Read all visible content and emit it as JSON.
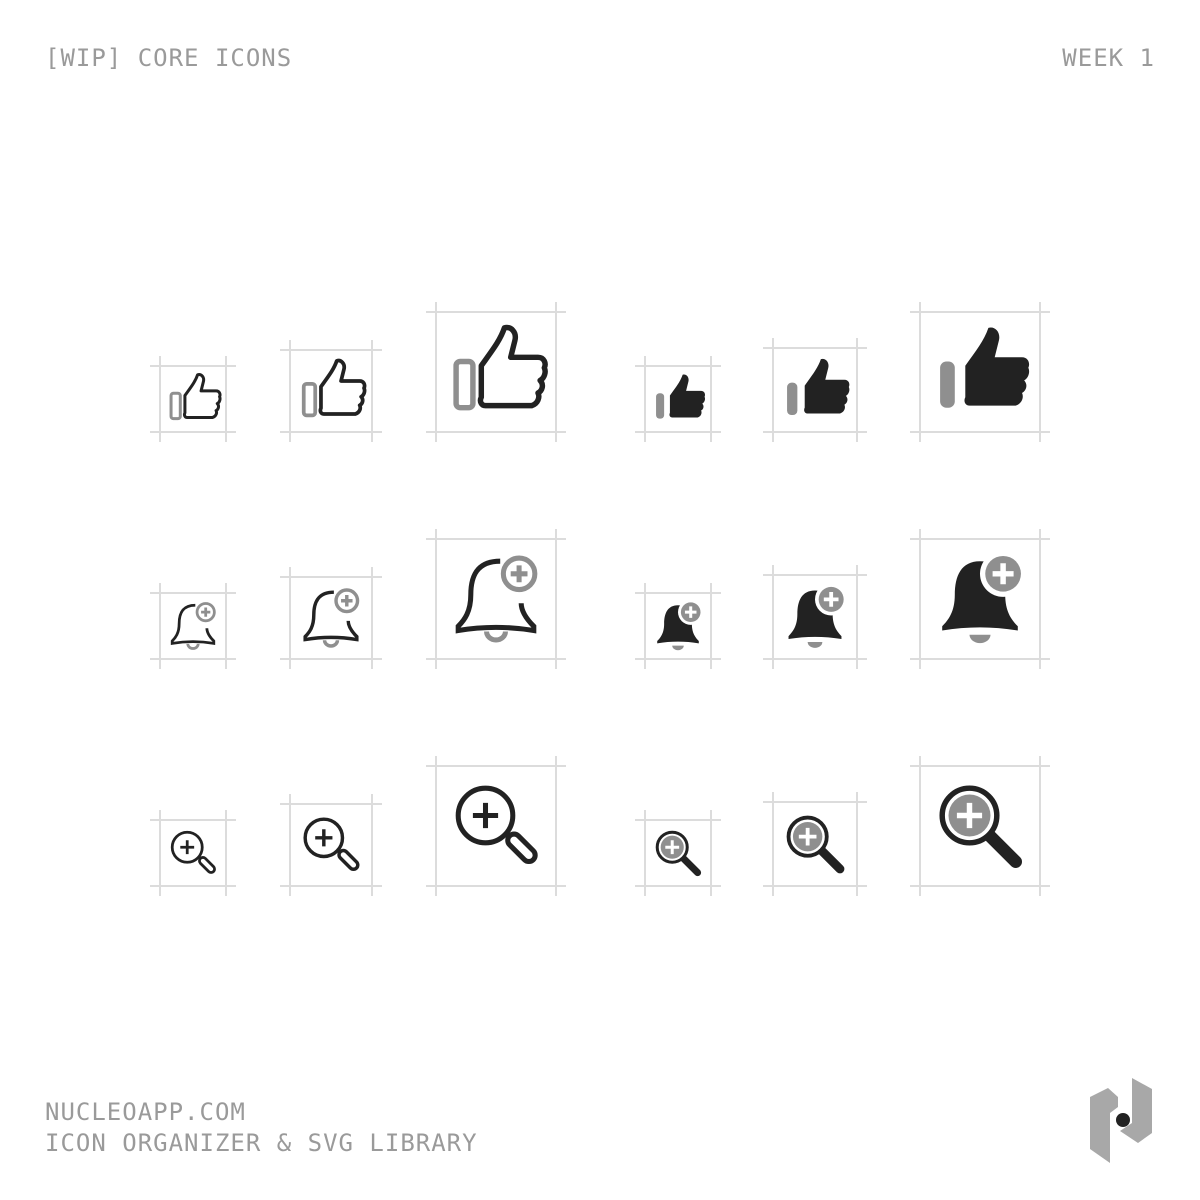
{
  "header": {
    "title": "[WIP] CORE ICONS",
    "week": "WEEK 1"
  },
  "footer": {
    "site": "NUCLEOAPP.COM",
    "tagline": "ICON ORGANIZER & SVG LIBRARY"
  },
  "colors": {
    "primary": "#222222",
    "secondary": "#8f8f8f",
    "grid": "#dcdcdc",
    "text": "#9a9a9a"
  },
  "icon_rows": [
    {
      "name": "thumbs-up",
      "variants": [
        "outline-small",
        "outline-medium",
        "outline-large",
        "filled-small",
        "filled-medium",
        "filled-large"
      ]
    },
    {
      "name": "bell-add",
      "variants": [
        "outline-small",
        "outline-medium",
        "outline-large",
        "filled-small",
        "filled-medium",
        "filled-large"
      ]
    },
    {
      "name": "zoom-in",
      "variants": [
        "outline-small",
        "outline-medium",
        "outline-large",
        "filled-small",
        "filled-medium",
        "filled-large"
      ]
    }
  ],
  "logo": {
    "name": "nucleo-logo"
  }
}
